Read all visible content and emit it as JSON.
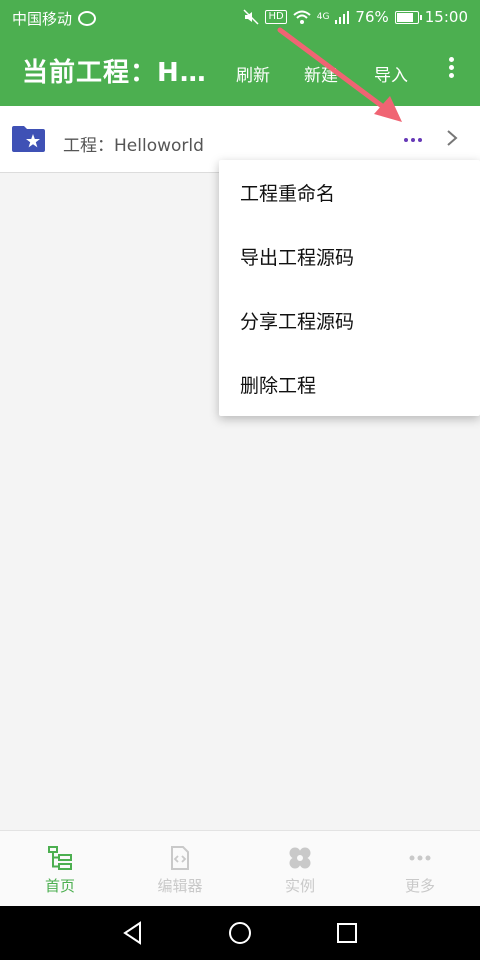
{
  "statusbar": {
    "carrier": "中国移动",
    "network": "4G",
    "battery": "76%",
    "battery_level": 0.76,
    "time": "15:00"
  },
  "appbar": {
    "title": "当前工程：Helloworld",
    "refresh": "刷新",
    "new": "新建",
    "import": "导入"
  },
  "project": {
    "label": "工程：Helloworld"
  },
  "menu": {
    "items": [
      "工程重命名",
      "导出工程源码",
      "分享工程源码",
      "删除工程"
    ]
  },
  "bottom_nav": {
    "items": [
      {
        "label": "首页",
        "icon": "tree-icon"
      },
      {
        "label": "编辑器",
        "icon": "code-file-icon"
      },
      {
        "label": "实例",
        "icon": "clover-icon"
      },
      {
        "label": "更多",
        "icon": "more-dots-icon"
      }
    ]
  },
  "colors": {
    "primary": "#4caf50",
    "accent_dots": "#673ab7",
    "folder": "#3f51b5",
    "arrow": "#f06473"
  }
}
